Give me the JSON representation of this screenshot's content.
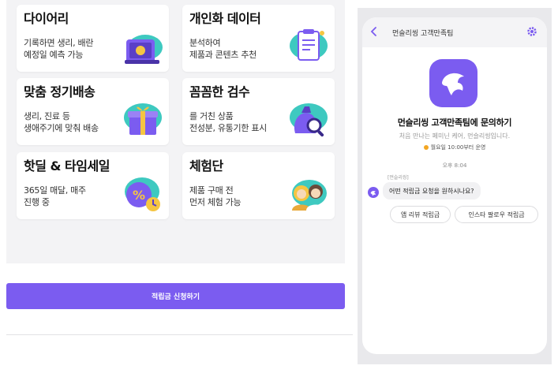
{
  "cards": [
    {
      "title": "다이어리",
      "desc": [
        "기록하면 생리, 배란",
        "예정일 예측 가능"
      ],
      "icon": "calendar-icon"
    },
    {
      "title": "개인화 데이터",
      "desc": [
        "분석하여",
        "제품과 콘텐츠 추천"
      ],
      "icon": "clipboard-icon"
    },
    {
      "title": "맞춤 정기배송",
      "desc": [
        "생리, 진료 등",
        "생애주기에 맞춰 배송"
      ],
      "icon": "gift-box-icon"
    },
    {
      "title": "꼼꼼한 검수",
      "desc": [
        "를 거친 상품",
        "전성분, 유통기한 표시"
      ],
      "icon": "magnifier-bag-icon"
    },
    {
      "title": "핫딜 & 타임세일",
      "desc": [
        "365일 매달, 매주",
        "진행 중"
      ],
      "icon": "sale-clock-icon"
    },
    {
      "title": "체험단",
      "desc": [
        "제품 구매 전",
        "먼저 체험 가능"
      ],
      "icon": "people-icon"
    }
  ],
  "apply_button": "적립금 신청하기",
  "chat": {
    "title": "먼슬리씽 고객만족팀",
    "heading": "먼슬리씽 고객만족팀에 문의하기",
    "subtitle": "처음 만나는 페미닌 케어, 먼슬리씽입니다.",
    "hours": "월요일 10:00부터 운영",
    "time": "오후 8:04",
    "sender": "[먼슬리씽]",
    "message": "어떤 적립금 요청을 원하시나요?",
    "choices": [
      "앱 리뷰 적립금",
      "인스타 팔로우 적립금"
    ]
  },
  "colors": {
    "accent": "#7b5cf0",
    "teal": "#3ec9c0"
  }
}
